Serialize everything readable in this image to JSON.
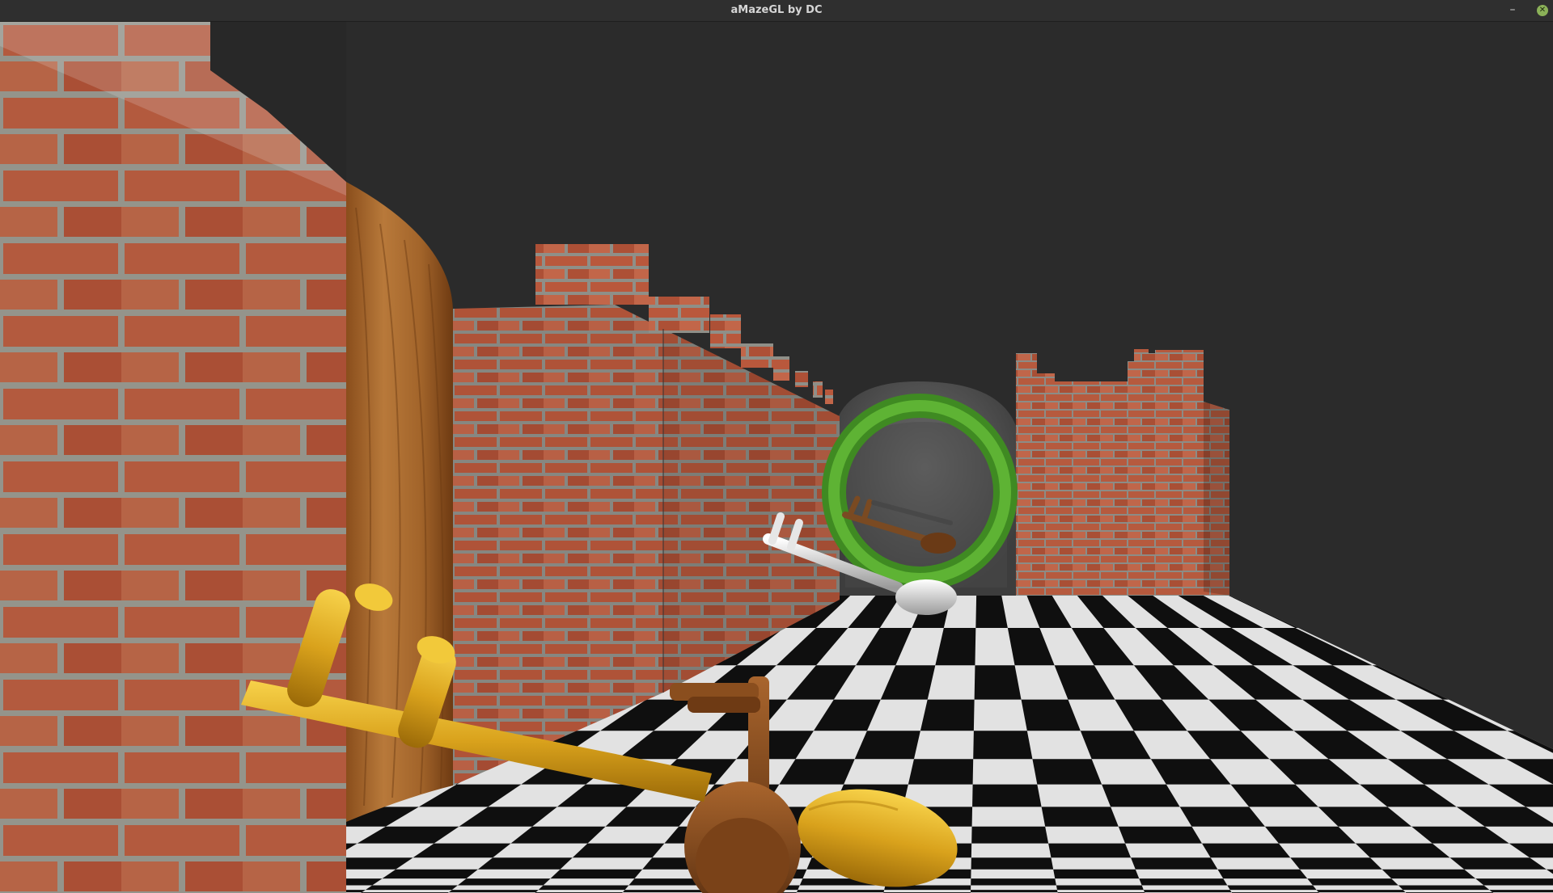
{
  "window": {
    "title": "aMazeGL by DC",
    "minimize_glyph": "–",
    "close_glyph": "✕"
  },
  "scene": {
    "background_color": "#2b2b2b",
    "brick_color": "#b85a3f",
    "mortar_color": "#9c9c93",
    "wood_color": "#a8682a",
    "stone_color": "#5b5b5b",
    "ring_color": "#4fa72d",
    "floor_dark": "#0f0f0f",
    "floor_light": "#e6e6e6",
    "objects": [
      {
        "name": "brick-wall-left",
        "icon": "brick-wall"
      },
      {
        "name": "wooden-door",
        "icon": "wood-panel"
      },
      {
        "name": "brick-wall-center",
        "icon": "brick-wall"
      },
      {
        "name": "stone-arch",
        "icon": "stone-arch"
      },
      {
        "name": "brick-wall-right",
        "icon": "brick-wall"
      },
      {
        "name": "green-ring",
        "icon": "torus-portal"
      },
      {
        "name": "silver-key",
        "icon": "key"
      },
      {
        "name": "bronze-key",
        "icon": "key"
      },
      {
        "name": "gold-key",
        "icon": "key"
      },
      {
        "name": "wooden-key",
        "icon": "key"
      },
      {
        "name": "checkered-floor",
        "icon": "checker-floor"
      }
    ]
  }
}
